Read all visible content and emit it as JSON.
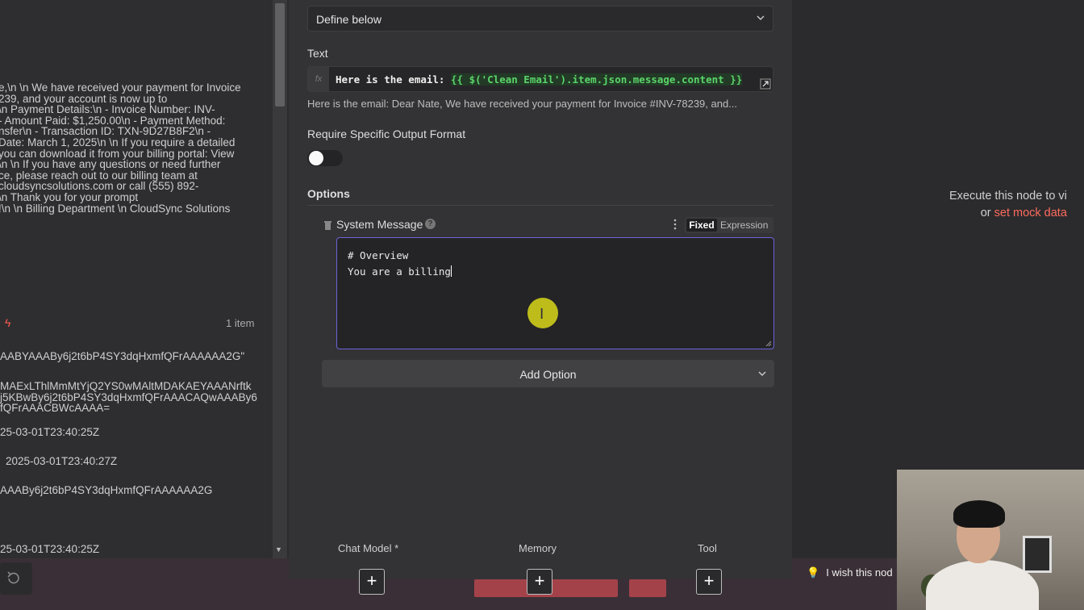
{
  "left_panel": {
    "message_text": "e,\\n \\n We have received your payment for Invoice\n239, and your account is now up to\n\\n Payment Details:\\n - Invoice Number: INV-\n- Amount Paid: $1,250.00\\n - Payment Method:\nnsfer\\n - Transaction ID: TXN-9D27B8F2\\n -\nDate: March 1, 2025\\n \\n If you require a detailed\nyou can download it from your billing portal: View\n\\n \\n If you have any questions or need further\nce, please reach out to our billing team at\ncloudsyncsolutions.com or call (555) 892-\n\\n Thank you for your prompt\n!\\n \\n Billing Department \\n CloudSync Solutions",
    "item_count": "1 item",
    "values": [
      "AABYAAABy6j2t6bP4SY3dqHxmfQFrAAAAAA2G\"",
      "MAExLThlMmMtYjQ2YS0wMAltMDAKAEYAAANrftk\nj5KBwBy6j2t6bP4SY3dqHxmfQFrAAACAQwAAABy6\nfQFrAAACBWcAAAA=",
      "25-03-01T23:40:25Z",
      "2025-03-01T23:40:27Z",
      "AAABy6j2t6bP4SY3dqHxmfQFrAAAAAA2G",
      "25-03-01T23:40:25Z"
    ]
  },
  "form": {
    "prompt_select_value": "Define below",
    "text_label": "Text",
    "fx_label": "fx",
    "expression_prefix": "Here is the email: ",
    "expression_code": "{{ $('Clean Email').item.json.message.content }}",
    "expression_preview": "Here is the email: Dear Nate, We have received your payment for Invoice #INV-78239, and...",
    "require_format_label": "Require Specific Output Format",
    "options_label": "Options",
    "system_message_label": "System Message",
    "help_glyph": "?",
    "mode_fixed": "Fixed",
    "mode_expression": "Expression",
    "system_message_value": "# Overview\nYou are a billing",
    "add_option_label": "Add Option"
  },
  "connectors": {
    "chat_model": "Chat Model *",
    "memory": "Memory",
    "tool": "Tool",
    "plus": "+"
  },
  "right_panel": {
    "message_line1": "Execute this node to vi",
    "message_or": "or ",
    "message_link": "set mock data"
  },
  "footer": {
    "tip_text": "I wish this nod",
    "bulb_glyph": "💡"
  },
  "colors": {
    "accent_purple": "#6b63d9",
    "expression_green": "#5bd46a",
    "link_red": "#ff6b5e",
    "cursor_yellow": "#c7c51a"
  }
}
